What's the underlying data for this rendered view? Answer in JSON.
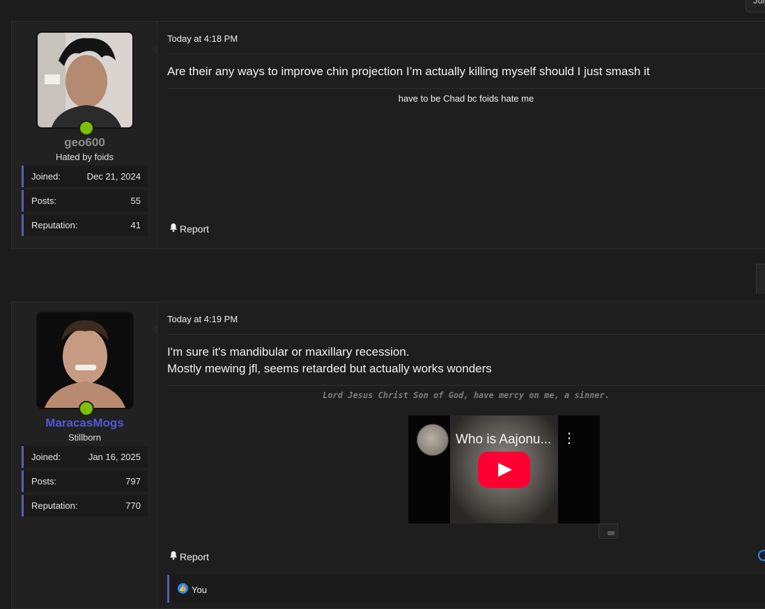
{
  "top_chip_label": "Jul",
  "posts": [
    {
      "username": "geo600",
      "user_title": "Hated by foids",
      "stats": [
        {
          "label": "Joined:",
          "value": "Dec 21, 2024"
        },
        {
          "label": "Posts:",
          "value": "55"
        },
        {
          "label": "Reputation:",
          "value": "41"
        }
      ],
      "timestamp": "Today at 4:18 PM",
      "body_lines": [
        "Are their any ways to improve chin projection I’m actually killing myself should I just smash it"
      ],
      "signature": "have to be Chad bc foids hate me",
      "report_label": "Report"
    },
    {
      "username": "MaracasMogs",
      "user_title": "Stillborn",
      "stats": [
        {
          "label": "Joined:",
          "value": "Jan 16, 2025"
        },
        {
          "label": "Posts:",
          "value": "797"
        },
        {
          "label": "Reputation:",
          "value": "770"
        }
      ],
      "timestamp": "Today at 4:19 PM",
      "body_lines": [
        "I'm sure it's mandibular or maxillary recession.",
        "Mostly mewing jfl, seems retarded but actually works wonders"
      ],
      "signature": "Lord Jesus Christ Son of God, have mercy on me, a sinner.",
      "video_title": "Who is Aajonu...",
      "report_label": "Report",
      "reaction_label": "You"
    }
  ],
  "colors": {
    "online": "#7cc000",
    "username_blue": "#4d5bd8",
    "accent_border": "#5a5fb0",
    "youtube_red": "#ff0033",
    "like_blue": "#2d88ff"
  }
}
